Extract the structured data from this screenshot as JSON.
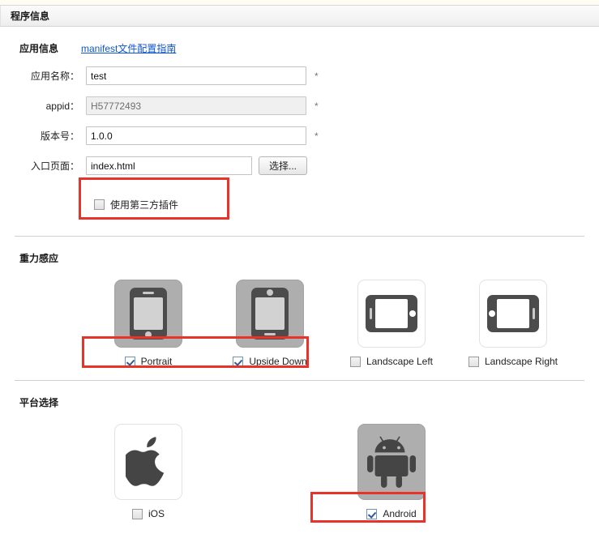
{
  "header": {
    "title": "程序信息"
  },
  "app_info": {
    "section_title": "应用信息",
    "manifest_link": "manifest文件配置指南",
    "fields": [
      {
        "label": "应用名称：",
        "value": "test",
        "required_mark": "*",
        "disabled": false
      },
      {
        "label": "appid：",
        "value": "H57772493",
        "required_mark": "*",
        "disabled": true
      },
      {
        "label": "版本号：",
        "value": "1.0.0",
        "required_mark": "*",
        "disabled": false
      },
      {
        "label": "入口页面：",
        "value": "index.html",
        "required_mark": "",
        "disabled": false
      }
    ],
    "choose_button": "选择...",
    "plugin_checkbox": {
      "label": "使用第三方插件",
      "checked": false
    }
  },
  "gravity": {
    "section_title": "重力感应",
    "options": [
      {
        "label": "Portrait",
        "checked": true,
        "tile_selected": true,
        "icon": "phone-portrait-icon"
      },
      {
        "label": "Upside Down",
        "checked": true,
        "tile_selected": true,
        "icon": "phone-upside-down-icon"
      },
      {
        "label": "Landscape Left",
        "checked": false,
        "tile_selected": false,
        "icon": "phone-landscape-left-icon"
      },
      {
        "label": "Landscape Right",
        "checked": false,
        "tile_selected": false,
        "icon": "phone-landscape-right-icon"
      }
    ]
  },
  "platform": {
    "section_title": "平台选择",
    "options": [
      {
        "label": "iOS",
        "checked": false,
        "tile_selected": false,
        "icon": "apple-logo-icon"
      },
      {
        "label": "Android",
        "checked": true,
        "tile_selected": true,
        "icon": "android-robot-icon"
      }
    ]
  },
  "annotations": {
    "highlight_color": "#e8332a",
    "boxes": [
      {
        "name": "plugin-checkbox-highlight"
      },
      {
        "name": "portrait-upsidedown-highlight"
      },
      {
        "name": "android-highlight"
      }
    ]
  }
}
